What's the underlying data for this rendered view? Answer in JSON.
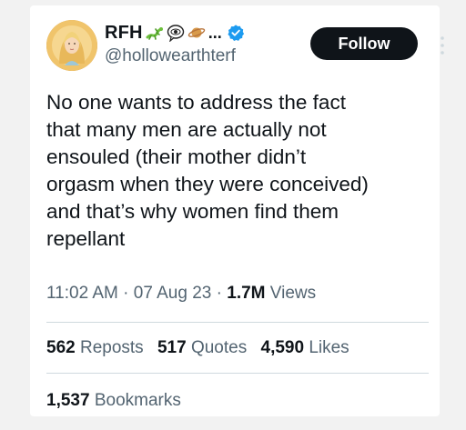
{
  "tweet": {
    "author": {
      "display_name": "RFH",
      "name_emojis": [
        "lizard-emoji",
        "eye-in-speech-bubble-emoji",
        "ringed-planet-emoji"
      ],
      "name_ellipsis": "...",
      "handle": "@hollowearthterf",
      "verified": true,
      "avatar": "avatar-image"
    },
    "follow_label": "Follow",
    "text_lines": [
      "No one wants to address the fact",
      "that many men are actually not",
      "ensouled (their mother didn’t",
      "orgasm when they were conceived)",
      "and that’s why women find them",
      "repellant"
    ],
    "time": "11:02 AM",
    "date": "07 Aug 23",
    "views_count": "1.7M",
    "views_label": "Views",
    "stats": {
      "reposts_count": "562",
      "reposts_label": "Reposts",
      "quotes_count": "517",
      "quotes_label": "Quotes",
      "likes_count": "4,590",
      "likes_label": "Likes",
      "bookmarks_count": "1,537",
      "bookmarks_label": "Bookmarks"
    },
    "colors": {
      "text_primary": "#0f1419",
      "text_secondary": "#536471",
      "verified_blue": "#1d9bf0",
      "button_bg": "#0f1419",
      "divider": "#cfd9de"
    }
  }
}
